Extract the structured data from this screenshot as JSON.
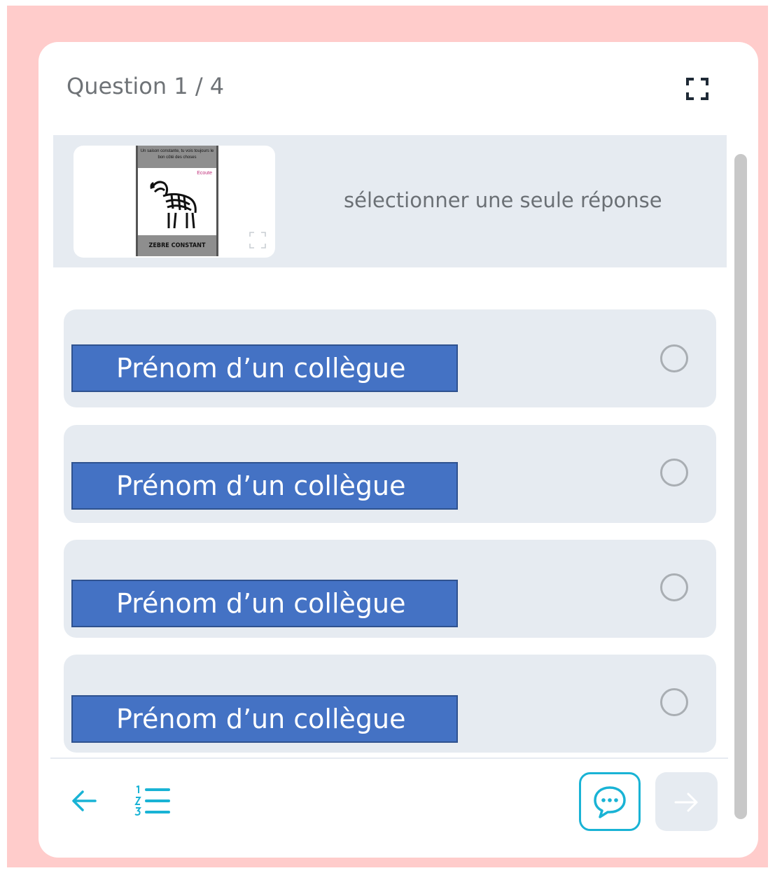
{
  "quiz": {
    "progress_label": "Question 1 / 4",
    "instruction": "sélectionner une seule réponse",
    "thumbnail": {
      "poster_caption_top": "Un saison constante, tu vois toujours le bon côté des choses",
      "poster_caption_bottom": "ZEBRE CONSTANT",
      "poster_brand": "Ecoute",
      "expand_icon": "expand-icon"
    },
    "options": [
      {
        "label": "Prénom d’un collègue",
        "selected": false
      },
      {
        "label": "Prénom d’un collègue",
        "selected": false
      },
      {
        "label": "Prénom d’un collègue",
        "selected": false
      },
      {
        "label": "Prénom d’un collègue",
        "selected": false
      }
    ]
  },
  "toolbar": {
    "fullscreen_icon": "fullscreen-icon",
    "back_icon": "arrow-left-icon",
    "list_icon": "numbered-list-icon",
    "chat_icon": "chat-bubble-icon",
    "next_icon": "arrow-right-icon"
  },
  "colors": {
    "frame": "#ffcccb",
    "accent": "#19b3d5",
    "option_bg": "#e6ebf1",
    "label_bg": "#4472c4"
  }
}
